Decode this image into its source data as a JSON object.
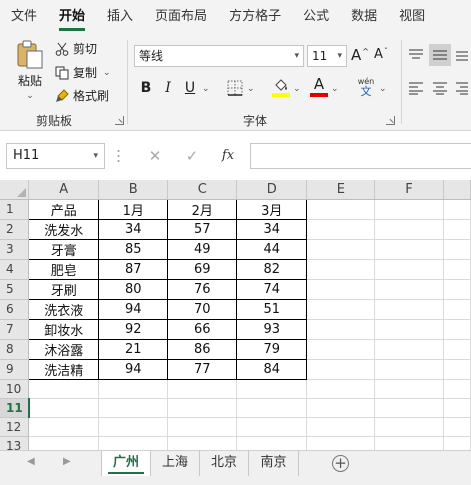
{
  "ribbon_tabs": [
    "文件",
    "开始",
    "插入",
    "页面布局",
    "方方格子",
    "公式",
    "数据",
    "视图"
  ],
  "active_tab_index": 1,
  "clipboard": {
    "paste_label": "粘贴",
    "cut_label": "剪切",
    "copy_label": "复制",
    "format_painter_label": "格式刷",
    "group_label": "剪贴板"
  },
  "font": {
    "name": "等线",
    "size": "11",
    "grow_label": "A",
    "shrink_label": "A",
    "bold": "B",
    "italic": "I",
    "underline": "U",
    "color_letter": "A",
    "phonetic_top": "wén",
    "phonetic_bottom": "文",
    "group_label": "字体",
    "highlight_color": "#ffff00",
    "font_color": "#e00000"
  },
  "formula_bar": {
    "name_box": "H11",
    "fx_label": "fx",
    "content": ""
  },
  "grid": {
    "columns": [
      "A",
      "B",
      "C",
      "D",
      "E",
      "F"
    ],
    "rows": [
      {
        "num": "1",
        "cells": [
          "产品",
          "1月",
          "2月",
          "3月"
        ]
      },
      {
        "num": "2",
        "cells": [
          "洗发水",
          "34",
          "57",
          "34"
        ]
      },
      {
        "num": "3",
        "cells": [
          "牙膏",
          "85",
          "49",
          "44"
        ]
      },
      {
        "num": "4",
        "cells": [
          "肥皂",
          "87",
          "69",
          "82"
        ]
      },
      {
        "num": "5",
        "cells": [
          "牙刷",
          "80",
          "76",
          "74"
        ]
      },
      {
        "num": "6",
        "cells": [
          "洗衣液",
          "94",
          "70",
          "51"
        ]
      },
      {
        "num": "7",
        "cells": [
          "卸妆水",
          "92",
          "66",
          "93"
        ]
      },
      {
        "num": "8",
        "cells": [
          "沐浴露",
          "21",
          "86",
          "79"
        ]
      },
      {
        "num": "9",
        "cells": [
          "洗洁精",
          "94",
          "77",
          "84"
        ]
      },
      {
        "num": "10",
        "cells": []
      },
      {
        "num": "11",
        "cells": []
      },
      {
        "num": "12",
        "cells": []
      },
      {
        "num": "13",
        "cells": []
      }
    ],
    "selected_row": "11"
  },
  "sheets": [
    "广州",
    "上海",
    "北京",
    "南京"
  ],
  "active_sheet_index": 0,
  "accent_color": "#1f7244"
}
